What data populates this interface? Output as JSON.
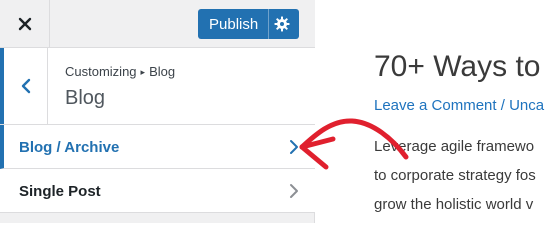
{
  "toolbar": {
    "close_icon": "close-icon",
    "publish_label": "Publish",
    "settings_icon": "gear-icon",
    "accent_color": "#2271b1"
  },
  "section": {
    "back_icon": "chevron-left-icon",
    "breadcrumb_parent": "Customizing",
    "breadcrumb_child": "Blog",
    "title": "Blog"
  },
  "menu": {
    "items": [
      {
        "label": "Blog / Archive",
        "active": true,
        "icon": "chevron-right-icon"
      },
      {
        "label": "Single Post",
        "active": false,
        "icon": "chevron-right-icon"
      }
    ]
  },
  "preview": {
    "post_title": "70+ Ways to",
    "post_meta": "Leave a Comment / Unca",
    "excerpt_lines": [
      "Leverage agile framewo",
      "to corporate strategy fos",
      "grow the holistic world v"
    ]
  },
  "annotation": {
    "arrow_color": "#e0202e"
  }
}
